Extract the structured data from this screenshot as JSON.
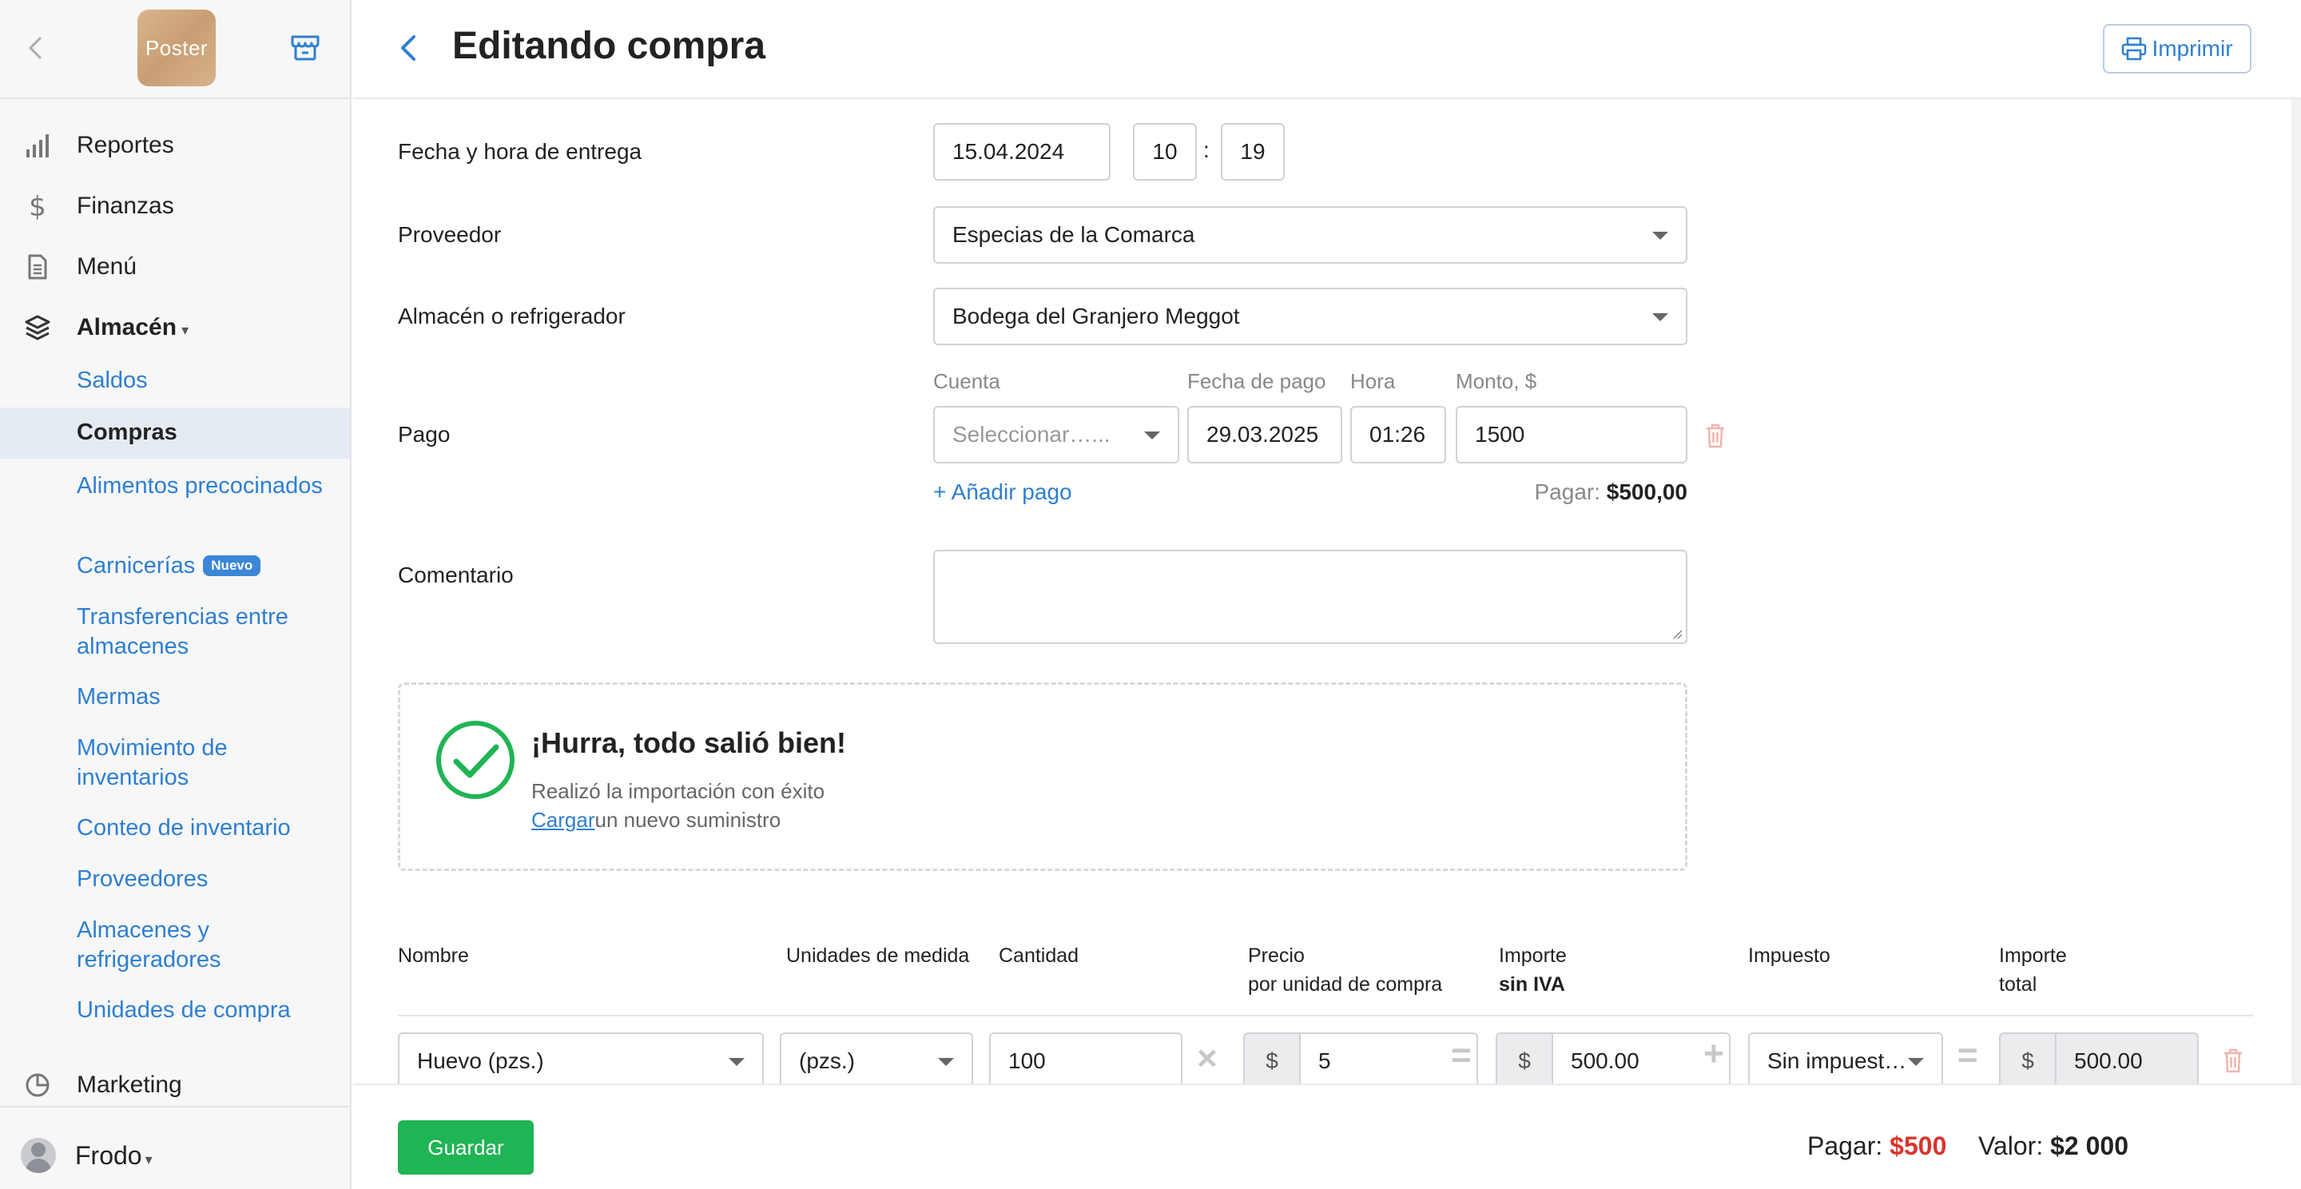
{
  "sidebar": {
    "logo_text": "Poster",
    "nav": [
      {
        "label": "Reportes"
      },
      {
        "label": "Finanzas"
      },
      {
        "label": "Menú"
      },
      {
        "label": "Almacén"
      }
    ],
    "sub": [
      {
        "label": "Saldos"
      },
      {
        "label": "Compras"
      },
      {
        "label": "Alimentos precocinados"
      },
      {
        "label": "Carnicerías"
      },
      {
        "label": "Transferencias entre almacenes"
      },
      {
        "label": "Mermas"
      },
      {
        "label": "Movimiento de inventarios"
      },
      {
        "label": "Conteo de inventario"
      },
      {
        "label": "Proveedores"
      },
      {
        "label": "Almacenes y refrigeradores"
      },
      {
        "label": "Unidades de compra"
      }
    ],
    "new_badge": "Nuevo",
    "marketing": "Marketing",
    "user": "Frodo"
  },
  "header": {
    "title": "Editando compra",
    "print_label": "Imprimir"
  },
  "form": {
    "delivery_label": "Fecha y hora de entrega",
    "delivery_date": "15.04.2024",
    "delivery_hour": "10",
    "time_sep": ":",
    "delivery_minute": "19",
    "supplier_label": "Proveedor",
    "supplier_value": "Especias de la Comarca",
    "warehouse_label": "Almacén o refrigerador",
    "warehouse_value": "Bodega del Granjero Meggot",
    "payment_label": "Pago",
    "col_account": "Cuenta",
    "col_paydate": "Fecha de pago",
    "col_hour": "Hora",
    "col_amount": "Monto, $",
    "account_placeholder": "Seleccionar…...",
    "pay_date": "29.03.2025",
    "pay_hour": "01:26",
    "pay_amount": "1500",
    "add_payment": "+ Añadir pago",
    "pay_total_label": "Pagar:",
    "pay_total_value": "$500,00",
    "comment_label": "Comentario"
  },
  "success": {
    "title": "¡Hurra, todo salió bien!",
    "line1": "Realizó la importación con éxito",
    "link": "Cargar",
    "line2_rest": "un nuevo suministro"
  },
  "table": {
    "headers": {
      "name": "Nombre",
      "units": "Unidades de medida",
      "qty": "Cantidad",
      "price_1": "Precio",
      "price_2": "por unidad de compra",
      "amount_1": "Importe",
      "amount_2": "sin IVA",
      "tax": "Impuesto",
      "total_1": "Importe",
      "total_2": "total"
    },
    "row": {
      "name": "Huevo (pzs.)",
      "unit": "(pzs.)",
      "qty": "100",
      "currency": "$",
      "price": "5",
      "amount": "500.00",
      "tax": "Sin impuest…",
      "total": "500.00"
    },
    "ops": {
      "times": "×",
      "equals": "=",
      "plus": "+"
    }
  },
  "footer": {
    "save_label": "Guardar",
    "pay_label": "Pagar:",
    "pay_value": "$500",
    "value_label": "Valor:",
    "value_value": "$2 000"
  },
  "colors": {
    "accent": "#2e7fd1",
    "success": "#1fb454",
    "danger": "#d9342b"
  }
}
